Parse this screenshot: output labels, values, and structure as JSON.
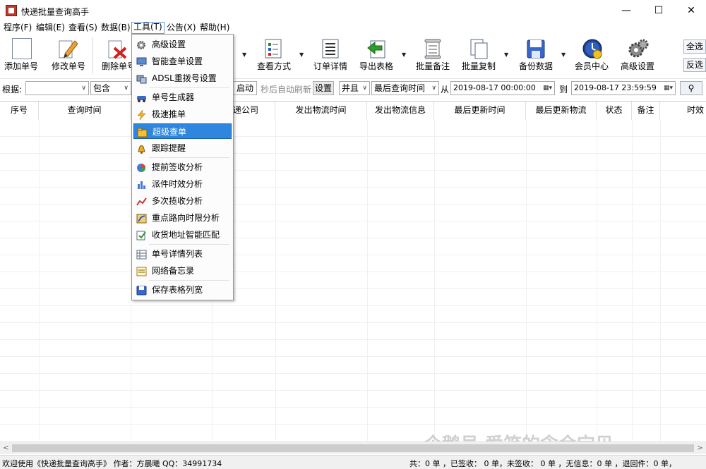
{
  "window": {
    "title": "快递批量查询高手",
    "minimize": "—",
    "maximize": "☐",
    "close": "✕"
  },
  "menubar": [
    {
      "label": "程序(F)"
    },
    {
      "label": "编辑(E)"
    },
    {
      "label": "查看(S)"
    },
    {
      "label": "数据(B)"
    },
    {
      "label": "工具(T)",
      "active": true
    },
    {
      "label": "公告(X)"
    },
    {
      "label": "帮助(H)"
    }
  ],
  "toolbar": {
    "add": "添加单号",
    "edit": "修改单号",
    "delete": "删除单号",
    "view_mode": "查看方式",
    "order_detail": "订单详情",
    "export": "导出表格",
    "batch_note": "批量备注",
    "batch_copy": "批量复制",
    "backup": "备份数据",
    "member": "会员中心",
    "advanced": "高级设置",
    "select_all": "全选",
    "invert": "反选"
  },
  "filter": {
    "label": "根据:",
    "field_value": "",
    "match_value": "包含",
    "start_fragment": "启动",
    "auto_refresh": "秒后自动刷新",
    "settings": "设置",
    "logic": "并且",
    "time_field": "最后查询时间",
    "from_label": "从",
    "from_value": "2019-08-17 00:00:00",
    "to_label": "到",
    "to_value": "2019-08-17 23:59:59",
    "search_icon": "search-icon"
  },
  "columns": [
    "序号",
    "查询时间",
    "",
    "快递公司",
    "发出物流时间",
    "发出物流信息",
    "最后更新时间",
    "最后更新物流",
    "状态",
    "备注",
    "时效"
  ],
  "tools_menu": {
    "items": [
      {
        "label": "高级设置",
        "icon": "gear-icon"
      },
      {
        "label": "智能查单设置",
        "icon": "monitor-icon"
      },
      {
        "label": "ADSL重拨号设置",
        "icon": "network-icon"
      },
      {
        "label": "单号生成器",
        "icon": "car-icon"
      },
      {
        "label": "极速推单",
        "icon": "lightning-icon"
      },
      {
        "label": "超级查单",
        "icon": "folder-icon",
        "highlighted": true
      },
      {
        "label": "跟踪提醒",
        "icon": "bell-icon"
      },
      {
        "label": "提前签收分析",
        "icon": "pie-chart-icon"
      },
      {
        "label": "派件时效分析",
        "icon": "bar-chart-icon"
      },
      {
        "label": "多次揽收分析",
        "icon": "line-chart-icon"
      },
      {
        "label": "重点路向时限分析",
        "icon": "route-icon"
      },
      {
        "label": "收货地址智能匹配",
        "icon": "match-icon"
      },
      {
        "label": "单号详情列表",
        "icon": "list-icon"
      },
      {
        "label": "网络备忘录",
        "icon": "memo-icon"
      },
      {
        "label": "保存表格列宽",
        "icon": "save-icon"
      }
    ]
  },
  "scrollbar": {
    "left": "<",
    "right": ">"
  },
  "status": {
    "left": "欢迎使用《快递批量查询高手》 作者：方晨曦  QQ：34991734",
    "right": "共：0 单 ，已签收： 0 单，未签收： 0 单 ，无信息：0 单 ，退回件：0 单，"
  },
  "watermark": "企鹅号 爱笑的念余宝贝",
  "colors": {
    "highlight": "#2e86de",
    "app_icon": "#c0392b"
  }
}
